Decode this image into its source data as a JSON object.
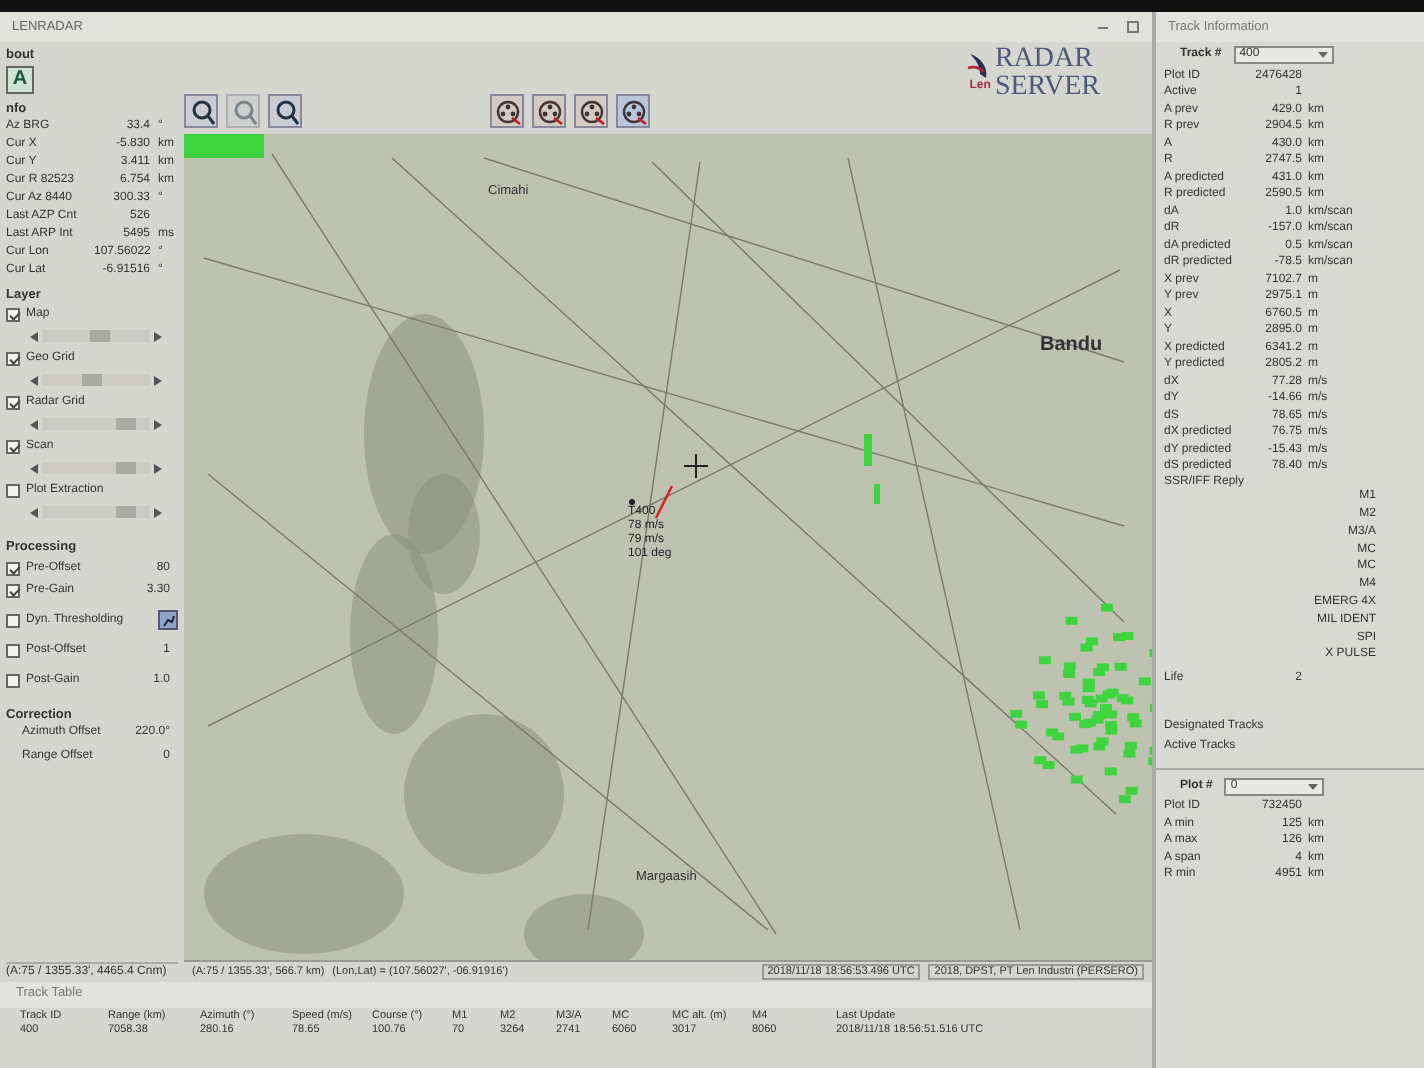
{
  "window": {
    "title": "LENRADAR"
  },
  "left_panel": {
    "about": {
      "title": "bout",
      "button": "A"
    },
    "info": {
      "title": "nfo",
      "rows": [
        {
          "label": "Az BRG",
          "value": "33.4",
          "unit": "°"
        },
        {
          "label": "Cur X",
          "value": "-5.830",
          "unit": "km"
        },
        {
          "label": "Cur Y",
          "value": "3.411",
          "unit": "km"
        },
        {
          "label": "Cur R 82523",
          "value": "6.754",
          "unit": "km"
        },
        {
          "label": "Cur Az 8440",
          "value": "300.33",
          "unit": "°"
        },
        {
          "label": "Last AZP Cnt",
          "value": "526"
        },
        {
          "label": "Last ARP Int",
          "value": "5495",
          "unit": "ms"
        },
        {
          "label": "Cur Lon",
          "value": "107.56022",
          "unit": "°"
        },
        {
          "label": "Cur Lat",
          "value": "-6.91516",
          "unit": "°"
        }
      ]
    },
    "layer": {
      "title": "Layer",
      "items": [
        {
          "label": "Map",
          "checked": true,
          "level": 0.55
        },
        {
          "label": "Geo Grid",
          "checked": true,
          "level": 0.45
        },
        {
          "label": "Radar Grid",
          "checked": true,
          "level": 0.85
        },
        {
          "label": "Scan",
          "checked": true,
          "level": 0.85
        },
        {
          "label": "Plot Extraction",
          "checked": false,
          "level": 0.85
        }
      ]
    },
    "processing": {
      "title": "Processing",
      "items": [
        {
          "kind": "value",
          "label": "Pre-Offset",
          "checked": true,
          "value": "80"
        },
        {
          "kind": "value",
          "label": "Pre-Gain",
          "checked": true,
          "value": "3.30"
        },
        {
          "kind": "button",
          "label": "Dyn. Thresholding",
          "checked": false
        },
        {
          "kind": "value",
          "label": "Post-Offset",
          "checked": false,
          "value": "1"
        },
        {
          "kind": "value",
          "label": "Post-Gain",
          "checked": false,
          "value": "1.0"
        }
      ]
    },
    "correction": {
      "title": "Correction",
      "rows": [
        {
          "label": "Azimuth Offset",
          "value": "220.0°"
        },
        {
          "label": "Range Offset",
          "value": "0"
        }
      ]
    },
    "status": "(A:75 / 1355.33', 4465.4 Cnm)"
  },
  "logo": {
    "brand": "Len",
    "line1": "RADAR",
    "line2": "SERVER"
  },
  "map": {
    "places": [
      "Cimahi",
      "Bandu",
      "Margaasih"
    ],
    "track_label": [
      "T400",
      "78 m/s",
      "79 m/s",
      "101 deg"
    ]
  },
  "map_status": [
    "(A:75 / 1355.33', 566.7 km)",
    "(Lon,Lat) = (107.56027', -06.91916')",
    "2018/11/18 18:56:53.496 UTC",
    "2018, DPST, PT Len Industri (PERSERO)"
  ],
  "track_table": {
    "title": "Track Table",
    "columns": [
      "Track ID",
      "Range (km)",
      "Azimuth (°)",
      "Speed (m/s)",
      "Course (°)",
      "M1",
      "M2",
      "M3/A",
      "MC",
      "MC alt. (m)",
      "M4",
      "Last Update"
    ],
    "rows": [
      [
        "400",
        "7058.38",
        "280.16",
        "78.65",
        "100.76",
        "70",
        "3264",
        "2741",
        "6060",
        "3017",
        "8060",
        "2018/11/18 18:56:51.516 UTC"
      ]
    ]
  },
  "track_info": {
    "title": "Track Information",
    "track_select": {
      "label": "Track #",
      "value": "400"
    },
    "rows": [
      {
        "label": "Plot ID",
        "value": "2476428"
      },
      {
        "label": "Active",
        "value": "1"
      },
      {
        "label": "A prev",
        "value": "429.0",
        "unit": "km"
      },
      {
        "label": "R prev",
        "value": "2904.5",
        "unit": "km"
      },
      {
        "label": "A",
        "value": "430.0",
        "unit": "km"
      },
      {
        "label": "R",
        "value": "2747.5",
        "unit": "km"
      },
      {
        "label": "A predicted",
        "value": "431.0",
        "unit": "km"
      },
      {
        "label": "R predicted",
        "value": "2590.5",
        "unit": "km"
      },
      {
        "label": "dA",
        "value": "1.0",
        "unit": "km/scan"
      },
      {
        "label": "dR",
        "value": "-157.0",
        "unit": "km/scan"
      },
      {
        "label": "dA predicted",
        "value": "0.5",
        "unit": "km/scan"
      },
      {
        "label": "dR predicted",
        "value": "-78.5",
        "unit": "km/scan"
      },
      {
        "label": "X prev",
        "value": "7102.7",
        "unit": "m"
      },
      {
        "label": "Y prev",
        "value": "2975.1",
        "unit": "m"
      },
      {
        "label": "X",
        "value": "6760.5",
        "unit": "m"
      },
      {
        "label": "Y",
        "value": "2895.0",
        "unit": "m"
      },
      {
        "label": "X predicted",
        "value": "6341.2",
        "unit": "m"
      },
      {
        "label": "Y predicted",
        "value": "2805.2",
        "unit": "m"
      },
      {
        "label": "dX",
        "value": "77.28",
        "unit": "m/s"
      },
      {
        "label": "dY",
        "value": "-14.66",
        "unit": "m/s"
      },
      {
        "label": "dS",
        "value": "78.65",
        "unit": "m/s"
      },
      {
        "label": "dX predicted",
        "value": "76.75",
        "unit": "m/s"
      },
      {
        "label": "dY predicted",
        "value": "-15.43",
        "unit": "m/s"
      },
      {
        "label": "dS predicted",
        "value": "78.40",
        "unit": "m/s"
      }
    ],
    "ssr": {
      "label": "SSR/IFF Reply",
      "modes": [
        "M1",
        "M2",
        "M3/A",
        "MC",
        "MC",
        "M4",
        "EMERG 4X",
        "MIL IDENT",
        "SPI",
        "X PULSE"
      ]
    },
    "life": {
      "label": "Life",
      "value": "2"
    },
    "footer": [
      "Designated Tracks",
      "Active Tracks"
    ],
    "plot_select": {
      "label": "Plot #",
      "value": "0"
    },
    "plot_rows": [
      {
        "label": "Plot ID",
        "value": "732450"
      },
      {
        "label": "A min",
        "value": "125",
        "unit": "km"
      },
      {
        "label": "A max",
        "value": "126",
        "unit": "km"
      },
      {
        "label": "A span",
        "value": "4",
        "unit": "km"
      },
      {
        "label": "R min",
        "value": "4951",
        "unit": "km"
      }
    ]
  }
}
